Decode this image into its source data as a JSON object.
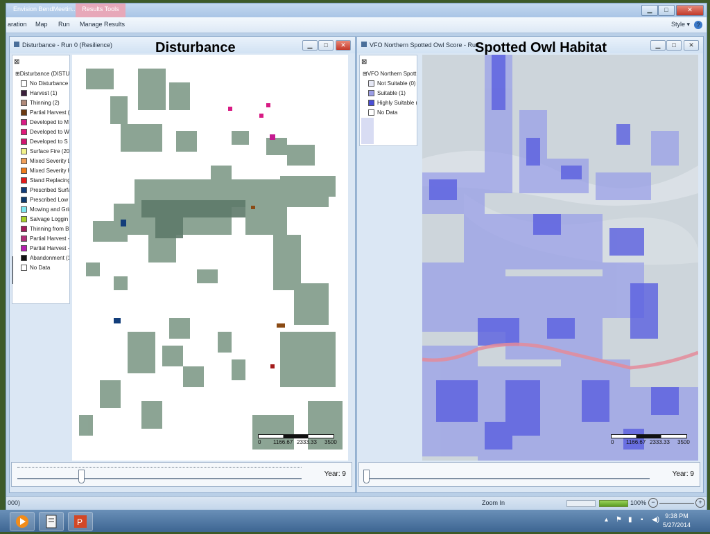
{
  "app": {
    "title": "Envision BendMeetin...",
    "context_tab": "Results Tools",
    "window_controls": {
      "minimize": "▁",
      "maximize": "□",
      "close": "✕"
    }
  },
  "menu": {
    "items": [
      "aration",
      "Map",
      "Run",
      "Manage Results"
    ],
    "style_label": "Style ▾",
    "help_label": "?"
  },
  "left_window": {
    "title": "Disturbance - Run 0 (Resilience)",
    "overlay_title": "Disturbance",
    "legend_close": "⊠",
    "legend_group": "⊞Disturbance (DISTU",
    "legend_items": [
      {
        "label": "No Disturbance",
        "color": "#ffffff"
      },
      {
        "label": "Harvest (1)",
        "color": "#3b1f3b"
      },
      {
        "label": "Thinning (2)",
        "color": "#b08a7a"
      },
      {
        "label": "Partial Harvest (",
        "color": "#6b3a12"
      },
      {
        "label": "Developed to M",
        "color": "#d81b84"
      },
      {
        "label": "Developed to W",
        "color": "#e0197a"
      },
      {
        "label": "Developed to S",
        "color": "#d01570"
      },
      {
        "label": "Surface Fire (20)",
        "color": "#f2f28a"
      },
      {
        "label": "Mixed Severity L",
        "color": "#f1a05a"
      },
      {
        "label": "Mixed Severity H",
        "color": "#ef7b1a"
      },
      {
        "label": "Stand Replacing",
        "color": "#e21b1b"
      },
      {
        "label": "Prescribed Surfa",
        "color": "#123d7a"
      },
      {
        "label": "Prescribed Low",
        "color": "#0f3b6e"
      },
      {
        "label": "Mowing and Grin",
        "color": "#7fe6ee"
      },
      {
        "label": "Salvage Loggin",
        "color": "#a8d12a"
      },
      {
        "label": "Thinning from Be",
        "color": "#a31b5a"
      },
      {
        "label": "Partial Harvest -",
        "color": "#b0307a"
      },
      {
        "label": "Partial Harvest -",
        "color": "#b51fae"
      },
      {
        "label": "Abandonment (1",
        "color": "#111111"
      },
      {
        "label": "No Data",
        "color": "#ffffff"
      }
    ],
    "scale": {
      "t0": "0",
      "t1": "1166.67",
      "t2": "2333.33",
      "t3": "3500"
    },
    "year_label": "Year: 9"
  },
  "right_window": {
    "title": "VFO Northern Spotted Owl Score - Run",
    "overlay_title": "Spotted Owl Habitat",
    "legend_close": "⊠",
    "legend_group": "⊞VFO Northern Spott",
    "legend_items": [
      {
        "label": "Not Suitable (0)",
        "color": "#e6e8f5"
      },
      {
        "label": "Suitable (1)",
        "color": "#9c9ee6"
      },
      {
        "label": "Highly Suitable (",
        "color": "#4b4fd6"
      },
      {
        "label": "No Data",
        "color": "#ffffff"
      }
    ],
    "scale": {
      "t0": "0",
      "t1": "1166.67",
      "t2": "2333.33",
      "t3": "3500"
    },
    "year_label": "Year: 9"
  },
  "status": {
    "left": "000)",
    "zoom_label": "Zoom In",
    "zoom_value": "100%"
  },
  "taskbar": {
    "time": "9:38 PM",
    "date": "5/27/2014"
  },
  "colors": {
    "forest": "#7f9a88",
    "owl_high": "#5a5fe0",
    "owl_low": "#9aa0e8",
    "terrain": "#cfd7dc",
    "river": "#e48b9a"
  }
}
